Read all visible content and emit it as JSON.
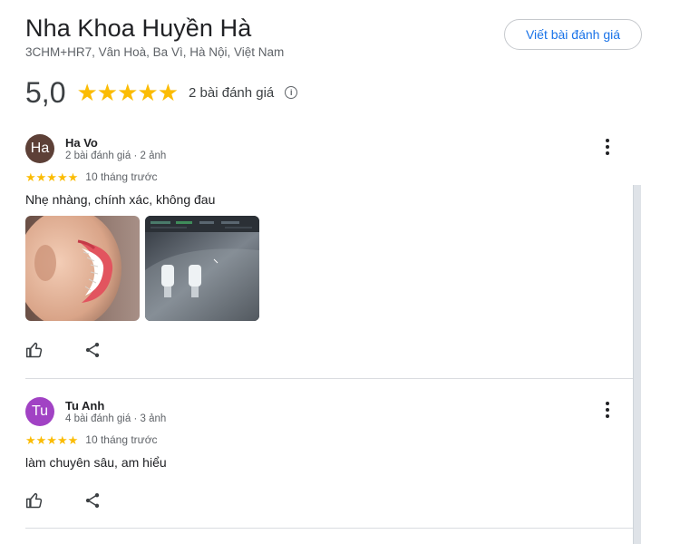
{
  "place": {
    "name": "Nha Khoa Huyền Hà",
    "address": "3CHM+HR7, Vân Hoà, Ba Vì, Hà Nội, Việt Nam",
    "write_review_label": "Viết bài đánh giá"
  },
  "summary": {
    "rating": "5,0",
    "stars": "★★★★★",
    "review_count": "2 bài đánh giá",
    "info_icon": "i"
  },
  "reviews": [
    {
      "avatar_text": "Ha",
      "avatar_color": "#5d4037",
      "author": "Ha Vo",
      "meta": "2 bài đánh giá · 2 ảnh",
      "stars": "★★★★★",
      "rating": 5,
      "time": "10 tháng trước",
      "text": "Nhẹ nhàng, chính xác, không đau",
      "photos": [
        "smile-photo",
        "dental-xray-photo"
      ]
    },
    {
      "avatar_text": "Tu",
      "avatar_color": "#a142c4",
      "author": "Tu Anh",
      "meta": "4 bài đánh giá · 3 ảnh",
      "stars": "★★★★★",
      "rating": 5,
      "time": "10 tháng trước",
      "text": "làm chuyên sâu, am hiểu",
      "photos": []
    }
  ],
  "icons": {
    "like": "thumb-up-icon",
    "share": "share-icon",
    "more": "more-vert-icon"
  },
  "colors": {
    "star": "#fbbc04",
    "link": "#1a73e8"
  }
}
